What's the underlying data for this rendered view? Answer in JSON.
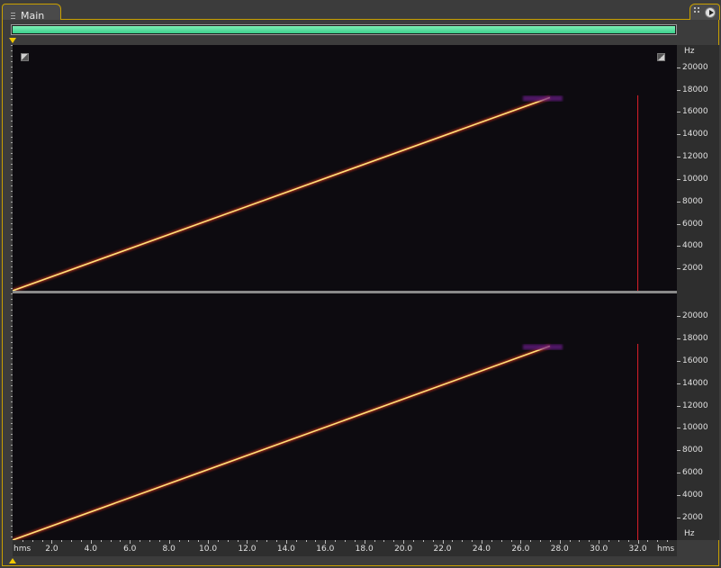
{
  "tab": {
    "label": "Main"
  },
  "colors": {
    "accent": "#c9a000",
    "overview": "#4fe0a0",
    "sweep": "#ffe27a",
    "cursor": "#e0202a"
  },
  "overview_fraction": 1.0,
  "y_axis": {
    "unit": "Hz",
    "ticks": [
      "20000",
      "18000",
      "16000",
      "14000",
      "12000",
      "10000",
      "8000",
      "6000",
      "4000",
      "2000"
    ]
  },
  "x_axis": {
    "unit": "hms",
    "ticks": [
      "2.0",
      "4.0",
      "6.0",
      "8.0",
      "10.0",
      "12.0",
      "14.0",
      "16.0",
      "18.0",
      "20.0",
      "22.0",
      "24.0",
      "26.0",
      "28.0",
      "30.0",
      "32.0"
    ]
  },
  "chart_data": {
    "type": "heatmap",
    "xlabel": "hms",
    "ylabel": "Hz",
    "xlim": [
      0,
      34.0
    ],
    "ylim": [
      0,
      22000
    ],
    "channels": 2,
    "sweep": {
      "start": [
        0,
        0
      ],
      "end": [
        27.5,
        17300
      ]
    },
    "cursor_time": 32.0
  }
}
